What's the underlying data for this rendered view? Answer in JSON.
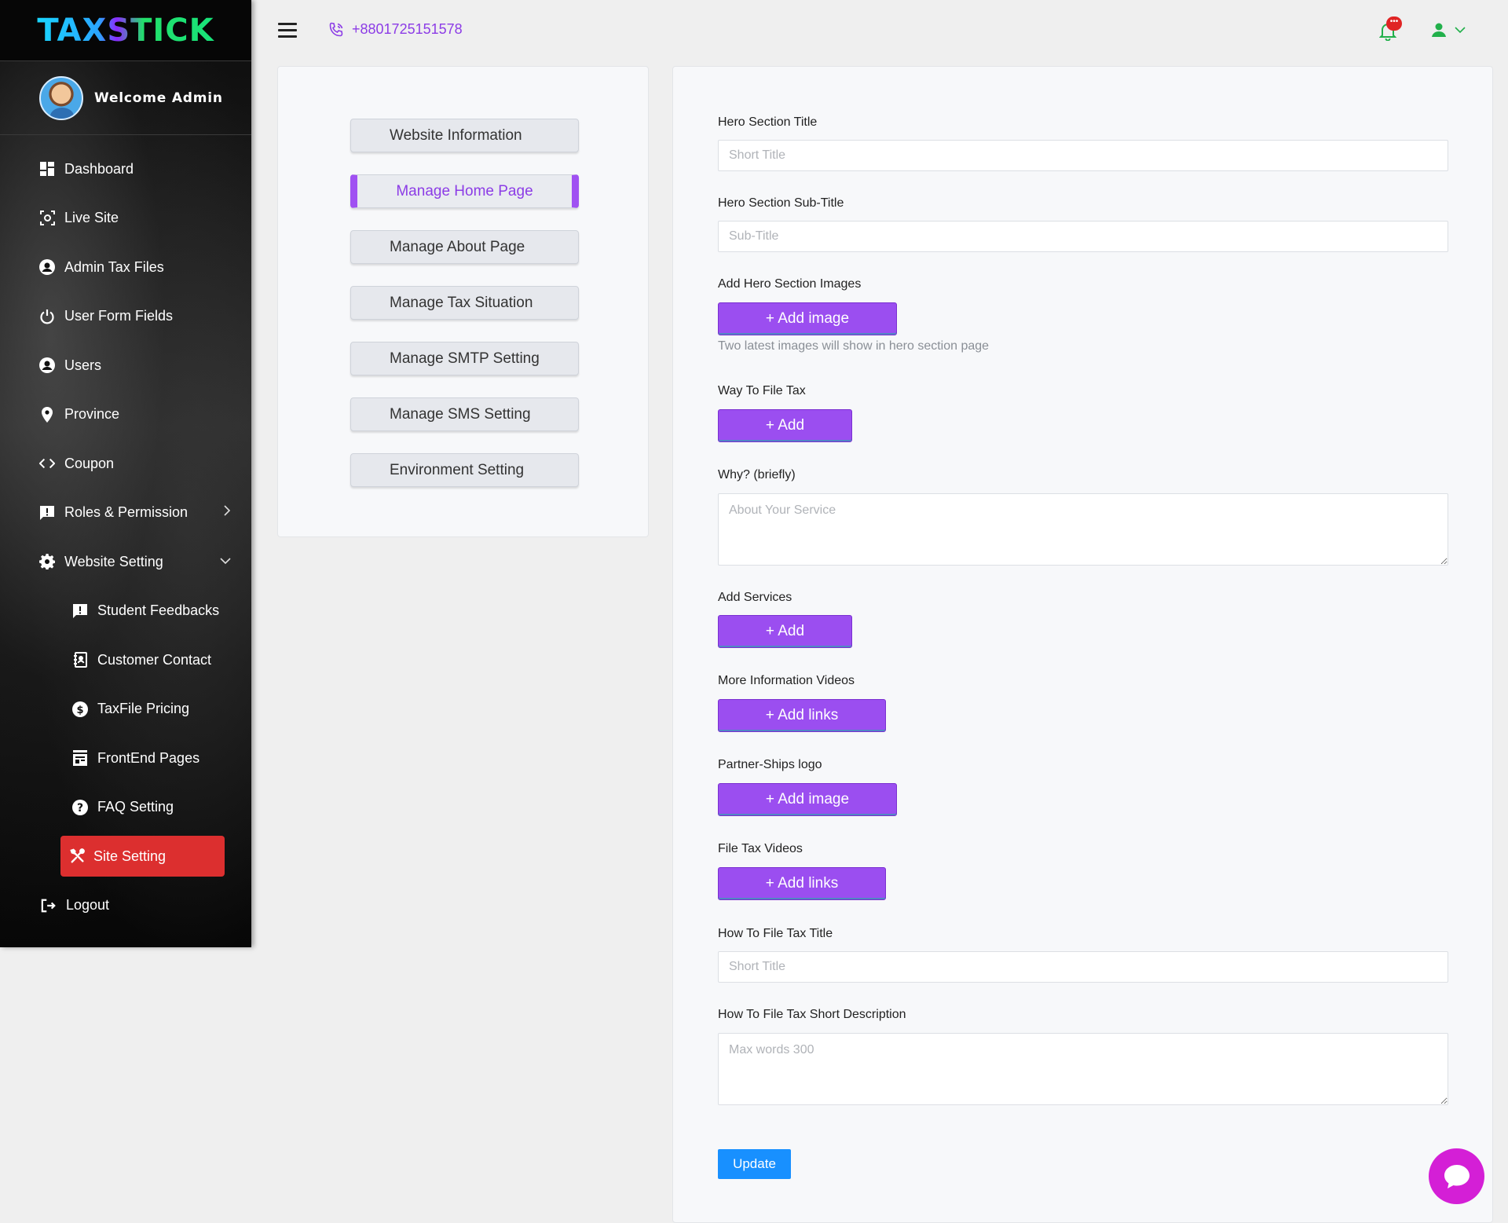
{
  "brand": {
    "logo": "TAXSTICK"
  },
  "user": {
    "welcome": "Welcome Admin"
  },
  "topbar": {
    "phone": "+8801725151578"
  },
  "sidebar": {
    "items": [
      {
        "label": "Dashboard",
        "icon": "dashboard-icon"
      },
      {
        "label": "Live Site",
        "icon": "screen-capture-icon"
      },
      {
        "label": "Admin Tax Files",
        "icon": "user-circle-icon"
      },
      {
        "label": "User Form Fields",
        "icon": "power-icon"
      },
      {
        "label": "Users",
        "icon": "user-circle-icon"
      },
      {
        "label": "Province",
        "icon": "map-pin-icon"
      },
      {
        "label": "Coupon",
        "icon": "code-icon"
      },
      {
        "label": "Roles & Permission",
        "icon": "alert-message-icon"
      },
      {
        "label": "Website Setting",
        "icon": "gear-icon"
      }
    ],
    "sub_items": [
      {
        "label": "Student Feedbacks",
        "icon": "feedback-icon"
      },
      {
        "label": "Customer Contact",
        "icon": "contact-book-icon"
      },
      {
        "label": "TaxFile Pricing",
        "icon": "dollar-circle-icon"
      },
      {
        "label": "FrontEnd Pages",
        "icon": "page-layout-icon"
      },
      {
        "label": "FAQ Setting",
        "icon": "question-circle-icon"
      },
      {
        "label": "Site Setting",
        "icon": "tools-icon"
      }
    ],
    "logout": "Logout"
  },
  "settings_menu": [
    "Website Information",
    "Manage Home Page",
    "Manage About Page",
    "Manage Tax Situation",
    "Manage SMTP Setting",
    "Manage SMS Setting",
    "Environment Setting"
  ],
  "form": {
    "hero_title": {
      "label": "Hero Section Title",
      "placeholder": "Short Title"
    },
    "hero_subtitle": {
      "label": "Hero Section Sub-Title",
      "placeholder": "Sub-Title"
    },
    "hero_images": {
      "label": "Add Hero Section Images",
      "button": "+ Add image",
      "hint": "Two latest images will show in hero section page"
    },
    "way_to_file": {
      "label": "Way To File Tax",
      "button": "+ Add"
    },
    "why": {
      "label": "Why? (briefly)",
      "placeholder": "About Your Service"
    },
    "services": {
      "label": "Add Services",
      "button": "+ Add"
    },
    "info_videos": {
      "label": "More Information Videos",
      "button": "+ Add links"
    },
    "partner_logo": {
      "label": "Partner-Ships logo",
      "button": "+ Add image"
    },
    "file_tax_videos": {
      "label": "File Tax Videos",
      "button": "+ Add links"
    },
    "how_title": {
      "label": "How To File Tax Title",
      "placeholder": "Short Title"
    },
    "how_desc": {
      "label": "How To File Tax Short Description",
      "placeholder": "Max words 300"
    },
    "update": "Update"
  },
  "colors": {
    "accent": "#9b4ef0",
    "active_nav": "#dc2f2f",
    "update": "#1890ff",
    "chat": "#d41fd6",
    "notify": "#22b04b"
  }
}
